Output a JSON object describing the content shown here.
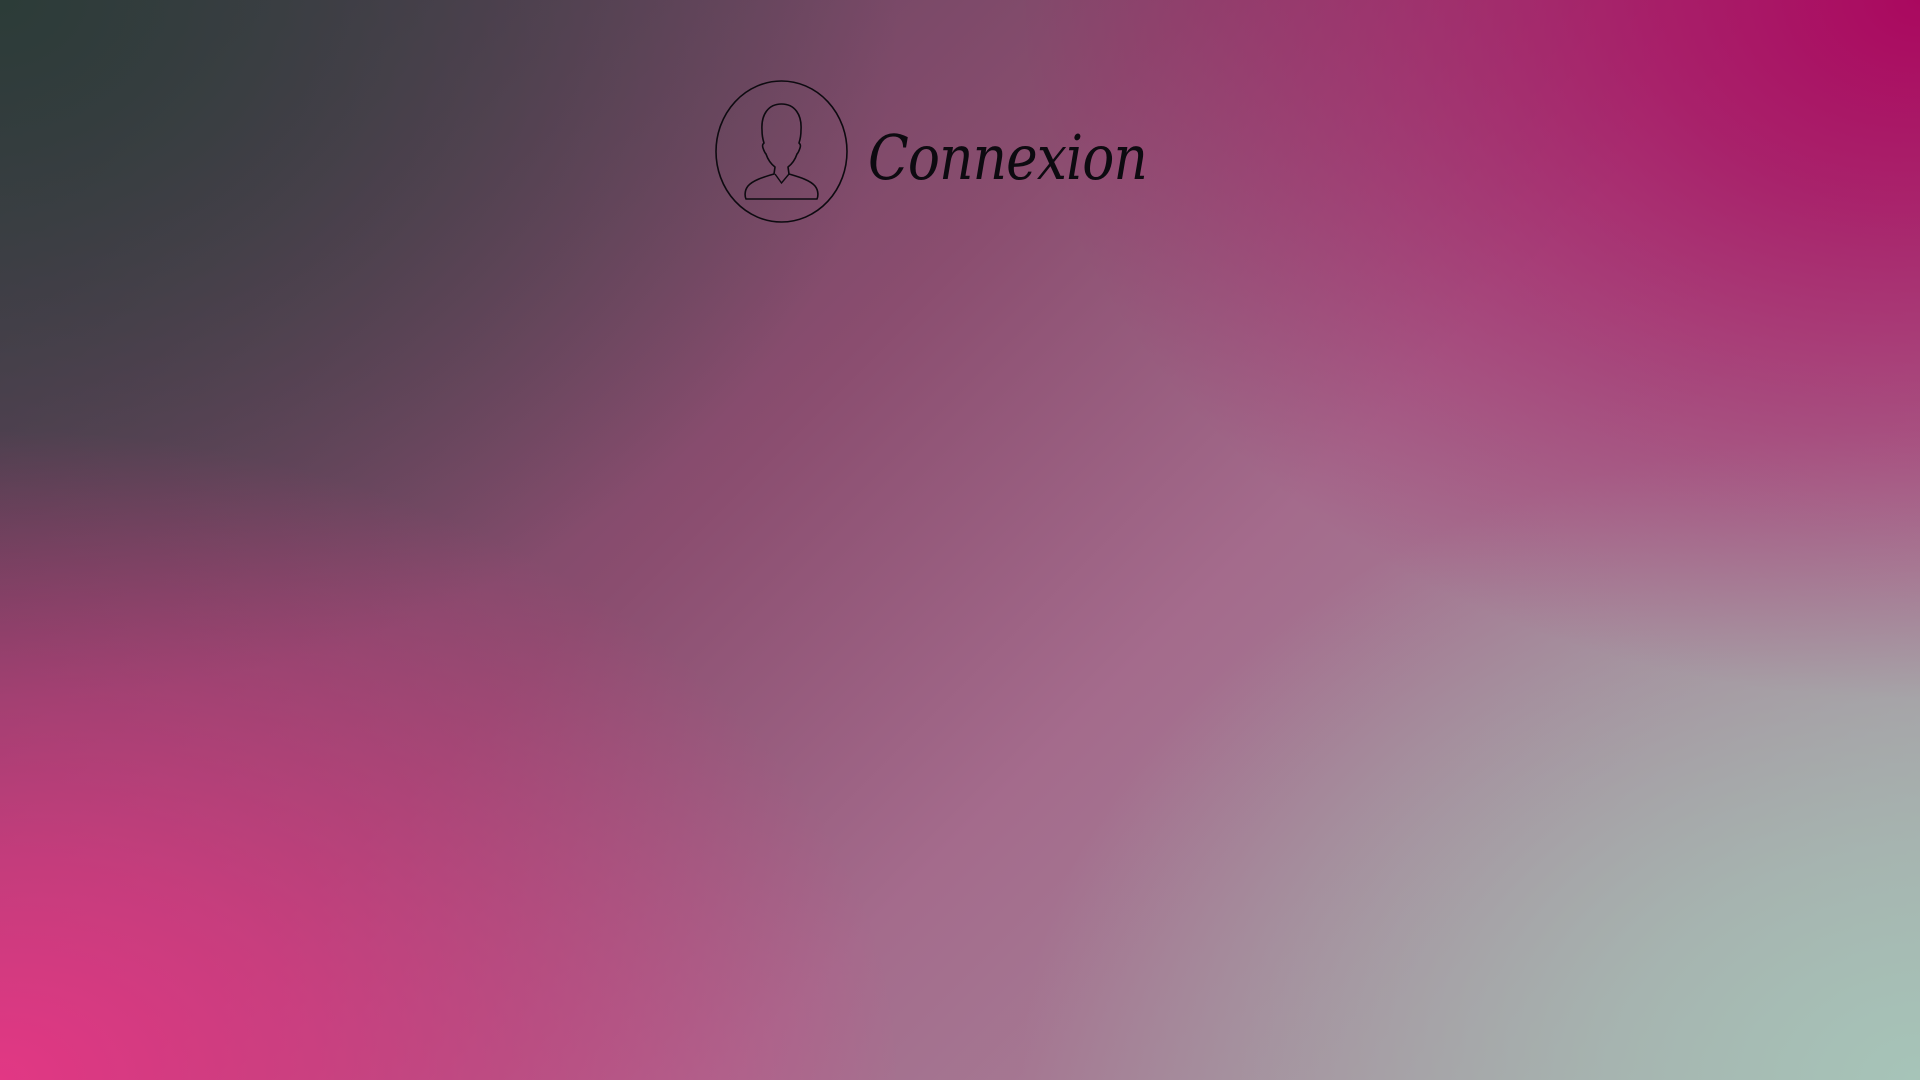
{
  "page": {
    "title": "Connexion"
  },
  "icons": {
    "avatar": "user-circle-icon"
  },
  "colors": {
    "top_left": "#2c3c38",
    "top_right": "#aa085f",
    "bottom_left": "#e23784",
    "bottom_right": "#a6c4b8",
    "text": "#0d0a10"
  }
}
